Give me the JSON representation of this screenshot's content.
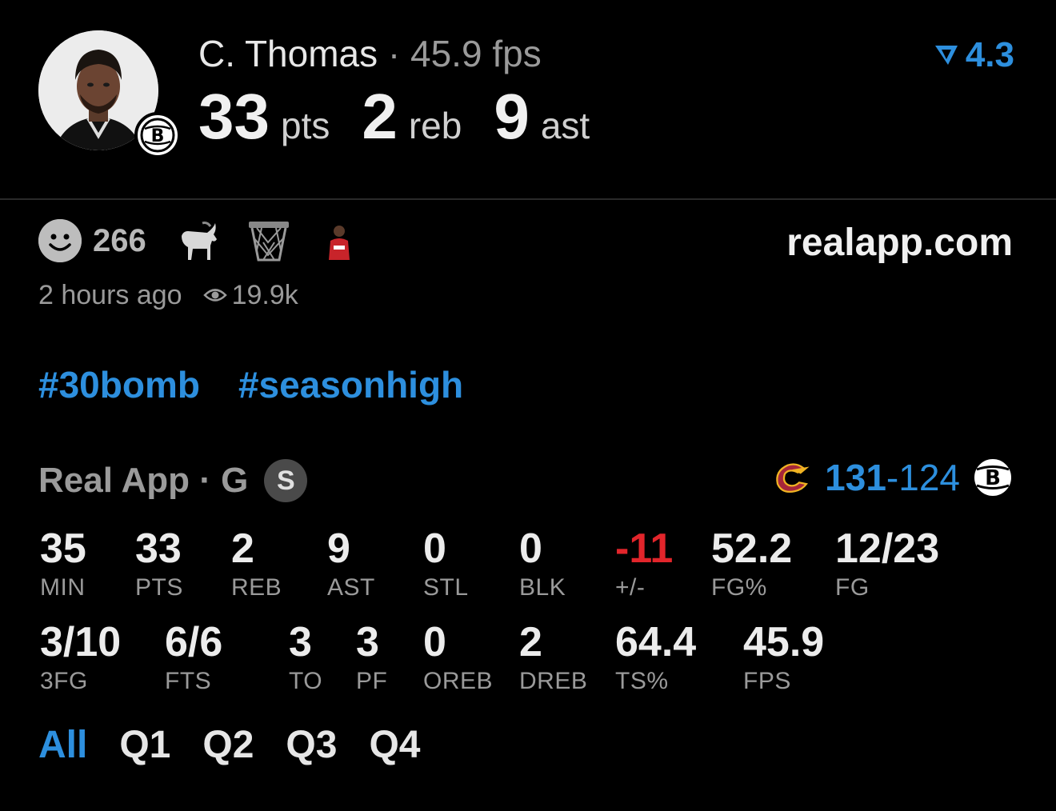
{
  "player": {
    "name": "C. Thomas",
    "separator": "·",
    "fps_text": "45.9 fps",
    "team_badge_letter": "B",
    "photo_icon": "player-headshot",
    "rating": "4.3",
    "rating_icon": "real-logo-icon"
  },
  "headline": [
    {
      "value": "33",
      "unit": "pts"
    },
    {
      "value": "2",
      "unit": "reb"
    },
    {
      "value": "9",
      "unit": "ast"
    }
  ],
  "reactions": {
    "count": "266",
    "icons": [
      "smiley-icon",
      "goat-icon",
      "basketball-net-icon",
      "player-sticker-icon"
    ]
  },
  "site": "realapp.com",
  "meta": {
    "time_ago": "2 hours ago",
    "views": "19.9k",
    "views_icon": "eye-icon"
  },
  "tags": [
    "#30bomb",
    "#seasonhigh"
  ],
  "game": {
    "title": "Real App · G",
    "sport_badge": "S",
    "home_logo": "cavaliers-logo-icon",
    "score_left": "131",
    "score_sep": "-",
    "score_right": "124",
    "away_logo": "nets-logo-icon"
  },
  "stats_row1": [
    {
      "value": "35",
      "label": "MIN"
    },
    {
      "value": "33",
      "label": "PTS"
    },
    {
      "value": "2",
      "label": "REB"
    },
    {
      "value": "9",
      "label": "AST"
    },
    {
      "value": "0",
      "label": "STL"
    },
    {
      "value": "0",
      "label": "BLK"
    },
    {
      "value": "-11",
      "label": "+/-"
    },
    {
      "value": "52.2",
      "label": "FG%"
    },
    {
      "value": "12/23",
      "label": "FG"
    }
  ],
  "stats_row2": [
    {
      "value": "3/10",
      "label": "3FG"
    },
    {
      "value": "6/6",
      "label": "FTS"
    },
    {
      "value": "3",
      "label": "TO"
    },
    {
      "value": "3",
      "label": "PF"
    },
    {
      "value": "0",
      "label": "OREB"
    },
    {
      "value": "2",
      "label": "DREB"
    },
    {
      "value": "64.4",
      "label": "TS%"
    },
    {
      "value": "45.9",
      "label": "FPS"
    }
  ],
  "quarters": [
    "All",
    "Q1",
    "Q2",
    "Q3",
    "Q4"
  ],
  "active_quarter": "All",
  "colors": {
    "accent": "#2d8fde",
    "negative": "#e2252b",
    "muted": "#9a9a9a",
    "background": "#000000"
  }
}
